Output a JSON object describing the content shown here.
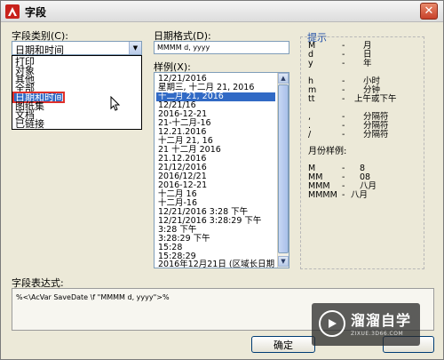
{
  "window": {
    "title": "字段",
    "close_label": "✕"
  },
  "category": {
    "label": "字段类别(C):",
    "selected": "日期和时间",
    "options": [
      "打印",
      "对象",
      "其他",
      "全部",
      "日期和时间",
      "图纸集",
      "文档",
      "已链接"
    ],
    "selected_index": 4
  },
  "format": {
    "label": "日期格式(D):",
    "value": "MMMM d, yyyy"
  },
  "examples": {
    "label": "样例(X):",
    "items": [
      "12/21/2016",
      "星期三, 十二月 21, 2016",
      "十二月 21, 2016",
      "12/21/16",
      "2016-12-21",
      "21-十二月-16",
      "12.21.2016",
      "十二月 21, 16",
      "21 十二月 2016",
      "21.12.2016",
      "21/12/2016",
      "2016/12/21",
      "2016-12-21",
      "十二月 16",
      "十二月-16",
      "12/21/2016 3:28 下午",
      "12/21/2016 3:28:29 下午",
      "3:28 下午",
      "3:28:29 下午",
      "15:28",
      "15:28:29",
      "2016年12月21日 (区域长日期"
    ],
    "selected_index": 2
  },
  "hints": {
    "title": "提示",
    "rows": [
      {
        "code": "M",
        "sep": "-",
        "desc": "月"
      },
      {
        "code": "d",
        "sep": "-",
        "desc": "日"
      },
      {
        "code": "y",
        "sep": "-",
        "desc": "年"
      },
      {
        "code": "h",
        "sep": "-",
        "desc": "小时"
      },
      {
        "code": "m",
        "sep": "-",
        "desc": "分钟"
      },
      {
        "code": "tt",
        "sep": "-",
        "desc": "上午或下午"
      },
      {
        "code": ",",
        "sep": "-",
        "desc": "分隔符"
      },
      {
        "code": ".",
        "sep": "-",
        "desc": "分隔符"
      },
      {
        "code": "/",
        "sep": "-",
        "desc": "分隔符"
      }
    ],
    "month_title": "月份样例:",
    "month_rows": [
      {
        "code": "M",
        "sep": "-",
        "desc": "8"
      },
      {
        "code": "MM",
        "sep": "-",
        "desc": "08"
      },
      {
        "code": "MMM",
        "sep": "-",
        "desc": "八月"
      },
      {
        "code": "MMMM",
        "sep": "-",
        "desc": "八月"
      }
    ]
  },
  "expression": {
    "label": "字段表达式:",
    "value": "%<\\AcVar SaveDate \\f \"MMMM d, yyyy\">%"
  },
  "buttons": {
    "ok": "确定"
  },
  "watermark": {
    "title": "溜溜自学",
    "subtitle": "ZIXUE.3D66.COM"
  }
}
